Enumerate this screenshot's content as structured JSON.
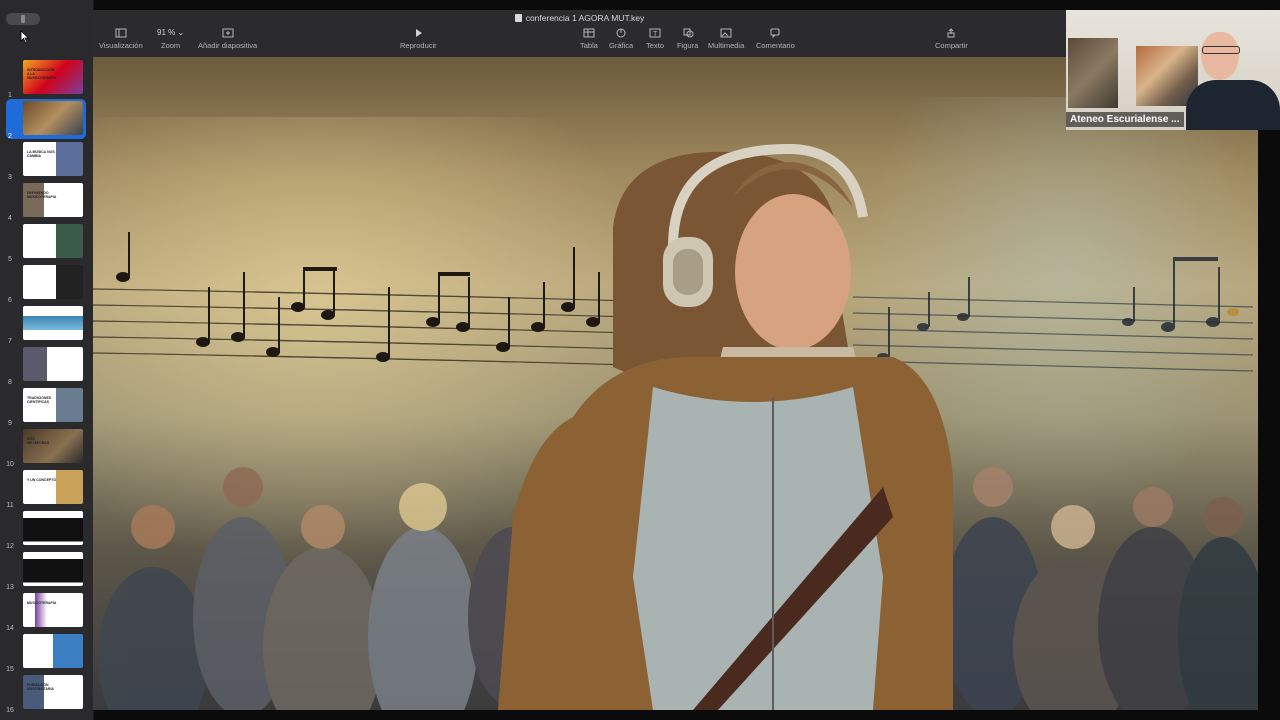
{
  "window": {
    "document_title": "conferencia 1 AGORA MUT.key"
  },
  "toolbar": {
    "view_label": "Visualización",
    "zoom_value": "91 %",
    "zoom_label": "Zoom",
    "add_slide_label": "Añadir diapositiva",
    "play_label": "Reproducir",
    "table_label": "Tabla",
    "chart_label": "Gráfica",
    "text_label": "Texto",
    "shape_label": "Figura",
    "media_label": "Multimedia",
    "comment_label": "Comentario",
    "share_label": "Compartir"
  },
  "slides": [
    {
      "num": "1",
      "text": "INTRODUCCIÓN A LA MUSICOTERAPIA"
    },
    {
      "num": "2",
      "text": ""
    },
    {
      "num": "3",
      "text": "LA MÚSICA NOS CAMBIA"
    },
    {
      "num": "4",
      "text": "DEFINIENDO MUSICOTERAPIA"
    },
    {
      "num": "5",
      "text": ""
    },
    {
      "num": "6",
      "text": ""
    },
    {
      "num": "7",
      "text": ""
    },
    {
      "num": "8",
      "text": ""
    },
    {
      "num": "9",
      "text": "TRADICIONES CIENTÍFICAS"
    },
    {
      "num": "10",
      "text": "DOS METÁFORAS"
    },
    {
      "num": "11",
      "text": "Y UN CONCEPTO"
    },
    {
      "num": "12",
      "text": ""
    },
    {
      "num": "13",
      "text": ""
    },
    {
      "num": "14",
      "text": "MUSICOTERAPIA"
    },
    {
      "num": "15",
      "text": ""
    },
    {
      "num": "16",
      "text": "FORMACIÓN UNIVERSITARIA"
    }
  ],
  "selected_slide": "2",
  "webcam": {
    "participant_name": "Ateneo Escurialense ..."
  },
  "colors": {
    "selection": "#1f6cd8",
    "toolbar_bg": "#2b2b2d",
    "sidebar_bg": "#2a2a2c"
  }
}
